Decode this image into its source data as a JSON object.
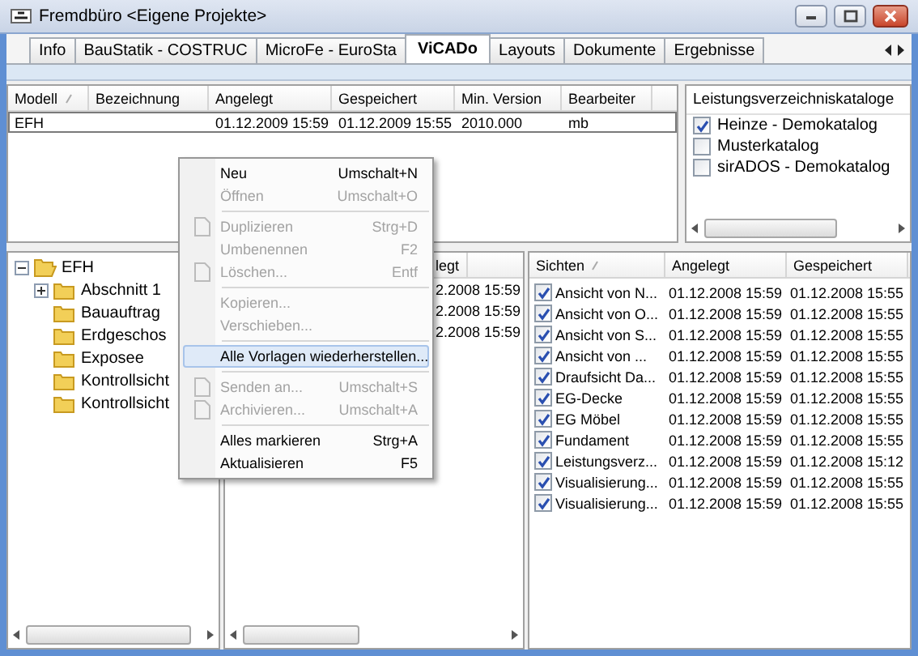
{
  "window": {
    "title": "Fremdbüro <Eigene Projekte>"
  },
  "tabs": [
    {
      "label": "Info",
      "selected": false
    },
    {
      "label": "BauStatik - COSTRUC",
      "selected": false
    },
    {
      "label": "MicroFe - EuroSta",
      "selected": false
    },
    {
      "label": "ViCADo",
      "selected": true
    },
    {
      "label": "Layouts",
      "selected": false
    },
    {
      "label": "Dokumente",
      "selected": false
    },
    {
      "label": "Ergebnisse",
      "selected": false
    }
  ],
  "models_table": {
    "columns": [
      {
        "label": "Modell",
        "sorted": true
      },
      {
        "label": "Bezeichnung",
        "sorted": false
      },
      {
        "label": "Angelegt",
        "sorted": false
      },
      {
        "label": "Gespeichert",
        "sorted": false
      },
      {
        "label": "Min. Version",
        "sorted": false
      },
      {
        "label": "Bearbeiter",
        "sorted": false
      }
    ],
    "rows": [
      {
        "cells": [
          "EFH",
          "",
          "01.12.2009 15:59",
          "01.12.2009 15:55",
          "2010.000",
          "mb"
        ],
        "selected": true
      }
    ]
  },
  "catalogs": {
    "title": "Leistungsverzeichniskataloge",
    "items": [
      {
        "label": "Heinze - Demokatalog",
        "checked": true
      },
      {
        "label": "Musterkatalog",
        "checked": false
      },
      {
        "label": "sirADOS - Demokatalog",
        "checked": false
      }
    ]
  },
  "tree": [
    {
      "label": "EFH",
      "expandable": true,
      "expanded": true,
      "children": [
        {
          "label": "Abschnitt 1",
          "expandable": true,
          "expanded": false
        },
        {
          "label": "Bauauftrag",
          "expandable": false
        },
        {
          "label": "Erdgeschos",
          "expandable": false
        },
        {
          "label": "Exposee",
          "expandable": false
        },
        {
          "label": "Kontrollsicht",
          "expandable": false
        },
        {
          "label": "Kontrollsicht",
          "expandable": false
        }
      ]
    }
  ],
  "middle_list": {
    "header": "legt",
    "cells": [
      "2.2008 15:59",
      "2.2008 15:59",
      "2.2008 15:59"
    ]
  },
  "views_table": {
    "columns": [
      {
        "label": "Sichten",
        "sorted": true
      },
      {
        "label": "Angelegt",
        "sorted": false
      },
      {
        "label": "Gespeichert",
        "sorted": false
      }
    ],
    "rows": [
      {
        "checked": true,
        "cells": [
          "Ansicht von N...",
          "01.12.2008 15:59",
          "01.12.2008 15:55"
        ]
      },
      {
        "checked": true,
        "cells": [
          "Ansicht von O...",
          "01.12.2008 15:59",
          "01.12.2008 15:55"
        ]
      },
      {
        "checked": true,
        "cells": [
          "Ansicht von S...",
          "01.12.2008 15:59",
          "01.12.2008 15:55"
        ]
      },
      {
        "checked": true,
        "cells": [
          "Ansicht von ...",
          "01.12.2008 15:59",
          "01.12.2008 15:55"
        ]
      },
      {
        "checked": true,
        "cells": [
          "Draufsicht Da...",
          "01.12.2008 15:59",
          "01.12.2008 15:55"
        ]
      },
      {
        "checked": true,
        "cells": [
          "EG-Decke",
          "01.12.2008 15:59",
          "01.12.2008 15:55"
        ]
      },
      {
        "checked": true,
        "cells": [
          "EG Möbel",
          "01.12.2008 15:59",
          "01.12.2008 15:55"
        ]
      },
      {
        "checked": true,
        "cells": [
          "Fundament",
          "01.12.2008 15:59",
          "01.12.2008 15:55"
        ]
      },
      {
        "checked": true,
        "cells": [
          "Leistungsverz...",
          "01.12.2008 15:59",
          "01.12.2008 15:12"
        ]
      },
      {
        "checked": true,
        "cells": [
          "Visualisierung...",
          "01.12.2008 15:59",
          "01.12.2008 15:55"
        ]
      },
      {
        "checked": true,
        "cells": [
          "Visualisierung...",
          "01.12.2008 15:59",
          "01.12.2008 15:55"
        ]
      }
    ]
  },
  "context_menu": [
    {
      "kind": "item",
      "label": "Neu",
      "shortcut": "Umschalt+N",
      "disabled": false,
      "icon": false,
      "selected": false
    },
    {
      "kind": "item",
      "label": "Öffnen",
      "shortcut": "Umschalt+O",
      "disabled": true,
      "icon": false,
      "selected": false
    },
    {
      "kind": "separator"
    },
    {
      "kind": "item",
      "label": "Duplizieren",
      "shortcut": "Strg+D",
      "disabled": true,
      "icon": true,
      "selected": false
    },
    {
      "kind": "item",
      "label": "Umbenennen",
      "shortcut": "F2",
      "disabled": true,
      "icon": false,
      "selected": false
    },
    {
      "kind": "item",
      "label": "Löschen...",
      "shortcut": "Entf",
      "disabled": true,
      "icon": true,
      "selected": false
    },
    {
      "kind": "separator"
    },
    {
      "kind": "item",
      "label": "Kopieren...",
      "disabled": true,
      "icon": false,
      "selected": false
    },
    {
      "kind": "item",
      "label": "Verschieben...",
      "disabled": true,
      "icon": false,
      "selected": false
    },
    {
      "kind": "separator"
    },
    {
      "kind": "item",
      "label": "Alle Vorlagen wiederherstellen...",
      "disabled": false,
      "icon": false,
      "selected": true
    },
    {
      "kind": "separator"
    },
    {
      "kind": "item",
      "label": "Senden an...",
      "shortcut": "Umschalt+S",
      "disabled": true,
      "icon": true,
      "selected": false
    },
    {
      "kind": "item",
      "label": "Archivieren...",
      "shortcut": "Umschalt+A",
      "disabled": true,
      "icon": true,
      "selected": false
    },
    {
      "kind": "separator"
    },
    {
      "kind": "item",
      "label": "Alles markieren",
      "shortcut": "Strg+A",
      "disabled": false,
      "icon": false,
      "selected": false
    },
    {
      "kind": "item",
      "label": "Aktualisieren",
      "shortcut": "F5",
      "disabled": false,
      "icon": false,
      "selected": false
    }
  ]
}
